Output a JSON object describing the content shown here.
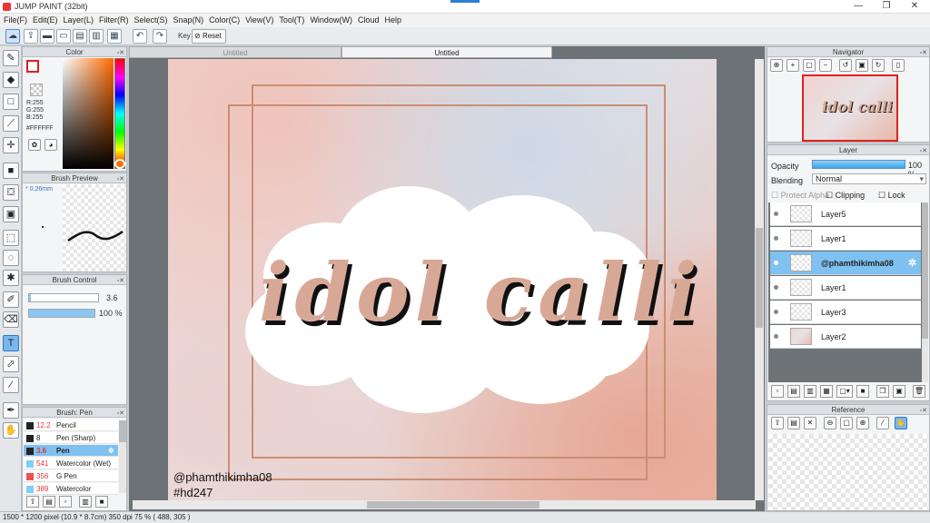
{
  "window": {
    "title": "JUMP PAINT (32bit)",
    "controls": [
      "—",
      "❐",
      "✕"
    ]
  },
  "menu": [
    "File(F)",
    "Edit(E)",
    "Layer(L)",
    "Filter(R)",
    "Select(S)",
    "Snap(N)",
    "Color(C)",
    "View(V)",
    "Tool(T)",
    "Window(W)",
    "Cloud",
    "Help"
  ],
  "toolbar": {
    "key_label": "Key",
    "reset_label": "Reset"
  },
  "color": {
    "title": "Color",
    "r": "R:255",
    "g": "G:255",
    "b": "B:255",
    "hex": "#FFFFFF",
    "main_border": "#e02020"
  },
  "brush_preview": {
    "title": "Brush Preview",
    "size": "0.26mm"
  },
  "brush_control": {
    "title": "Brush Control",
    "size_value": "3.6",
    "opacity_value": "100 %",
    "size_fraction": 0.02,
    "opacity_fraction": 1.0
  },
  "brush_list": {
    "title": "Brush: Pen",
    "items": [
      {
        "size": "12.2",
        "name": "Pencil",
        "color": "#222222"
      },
      {
        "size": "8",
        "name": "Pen (Sharp)",
        "color": "#222222"
      },
      {
        "size": "3.6",
        "name": "Pen",
        "color": "#222222"
      },
      {
        "size": "541",
        "name": "Watercolor (Wet)",
        "color": "#7fd0f5"
      },
      {
        "size": "356",
        "name": "G Pen",
        "color": "#ee5050"
      },
      {
        "size": "389",
        "name": "Watercolor",
        "color": "#7fd0f5"
      }
    ]
  },
  "document": {
    "tabs": [
      "Untitled",
      "Untitled"
    ],
    "art_text": "idol calli",
    "credit_line1": "@phamthikimha08",
    "credit_line2": "#hd247",
    "accent": "#d8a896"
  },
  "navigator": {
    "title": "Navigator"
  },
  "layer": {
    "title": "Layer",
    "opacity_label": "Opacity",
    "opacity_value": "100 %",
    "blending_label": "Blending",
    "blending_value": "Normal",
    "protect_alpha": "Protect Alpha",
    "clipping": "Clipping",
    "lock": "Lock",
    "items": [
      {
        "name": "Layer5"
      },
      {
        "name": "Layer1"
      },
      {
        "name": "@phamthikimha08"
      },
      {
        "name": "Layer1"
      },
      {
        "name": "Layer3"
      },
      {
        "name": "Layer2"
      }
    ]
  },
  "reference": {
    "title": "Reference"
  },
  "status": {
    "pixels": "1500 * 1200 pixel",
    "size": "(10.9 * 8.7cm)",
    "dpi": "350 dpi",
    "zoom": "75 %",
    "cursor": "( 488, 305 )"
  }
}
